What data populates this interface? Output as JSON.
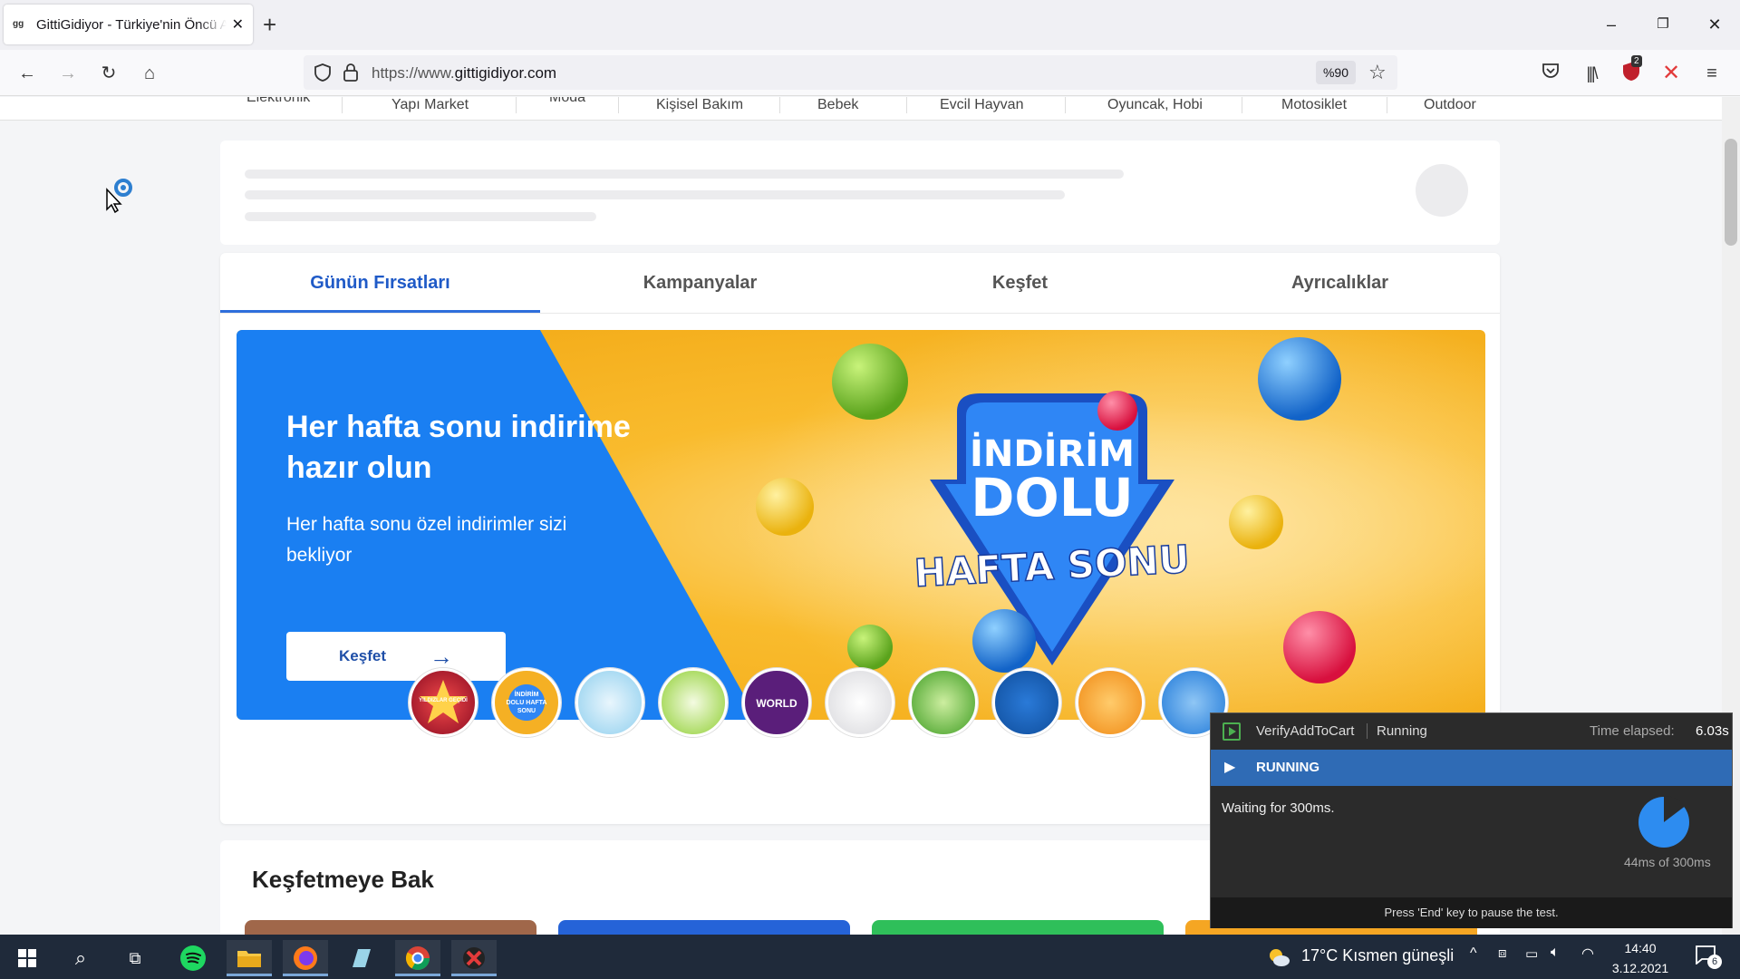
{
  "browser": {
    "tab_title": "GittiGidiyor - Türkiye'nin Öncü A",
    "favicon_text": "gg",
    "url_prefix": "https://www.",
    "url_domain": "gittigidiyor.com",
    "zoom": "%90",
    "shield_badge": "2"
  },
  "categories": [
    "Elektronik",
    "Yapı Market",
    "Moda",
    "Kişisel Bakım",
    "Bebek",
    "Evcil Hayvan",
    "Oyuncak, Hobi",
    "Motosiklet",
    "Outdoor"
  ],
  "nav_tabs": [
    "Günün Fırsatları",
    "Kampanyalar",
    "Keşfet",
    "Ayrıcalıklar"
  ],
  "banner": {
    "heading": "Her hafta sonu indirime hazır olun",
    "subtext": "Her hafta sonu özel indirimler sizi bekliyor",
    "button": "Keşfet",
    "badge_line1": "İNDİRİM",
    "badge_line2": "DOLU",
    "badge_line3": "HAFTA SONU"
  },
  "story_circles": [
    {
      "label": "YILDIZLAR GEÇİDİ",
      "color": "#c8102e"
    },
    {
      "label": "İNDİRİM DOLU HAFTA SONU",
      "color": "#1877f2"
    },
    {
      "label": "",
      "color": "#bfe4f6"
    },
    {
      "label": "",
      "color": "#9ed640"
    },
    {
      "label": "WORLD",
      "color": "#5a1e7a"
    },
    {
      "label": "",
      "color": "#e8e8ea"
    },
    {
      "label": "",
      "color": "#4caf2d"
    },
    {
      "label": "",
      "color": "#1560b8"
    },
    {
      "label": "",
      "color": "#f5a21a"
    },
    {
      "label": "",
      "color": "#1e88e5"
    }
  ],
  "section_title": "Keşfetmeye Bak",
  "runner": {
    "test_name": "VerifyAddToCart",
    "status": "Running",
    "elapsed_label": "Time elapsed:",
    "elapsed": "6.03s",
    "state": "RUNNING",
    "message": "Waiting for 300ms.",
    "progress_ms": "44ms",
    "progress_of": "of 300ms",
    "progress_fraction": 0.147,
    "footer": "Press 'End' key to pause the test."
  },
  "taskbar": {
    "weather": "17°C  Kısmen güneşli",
    "time": "14:40",
    "date": "3.12.2021",
    "notif_count": "6"
  }
}
